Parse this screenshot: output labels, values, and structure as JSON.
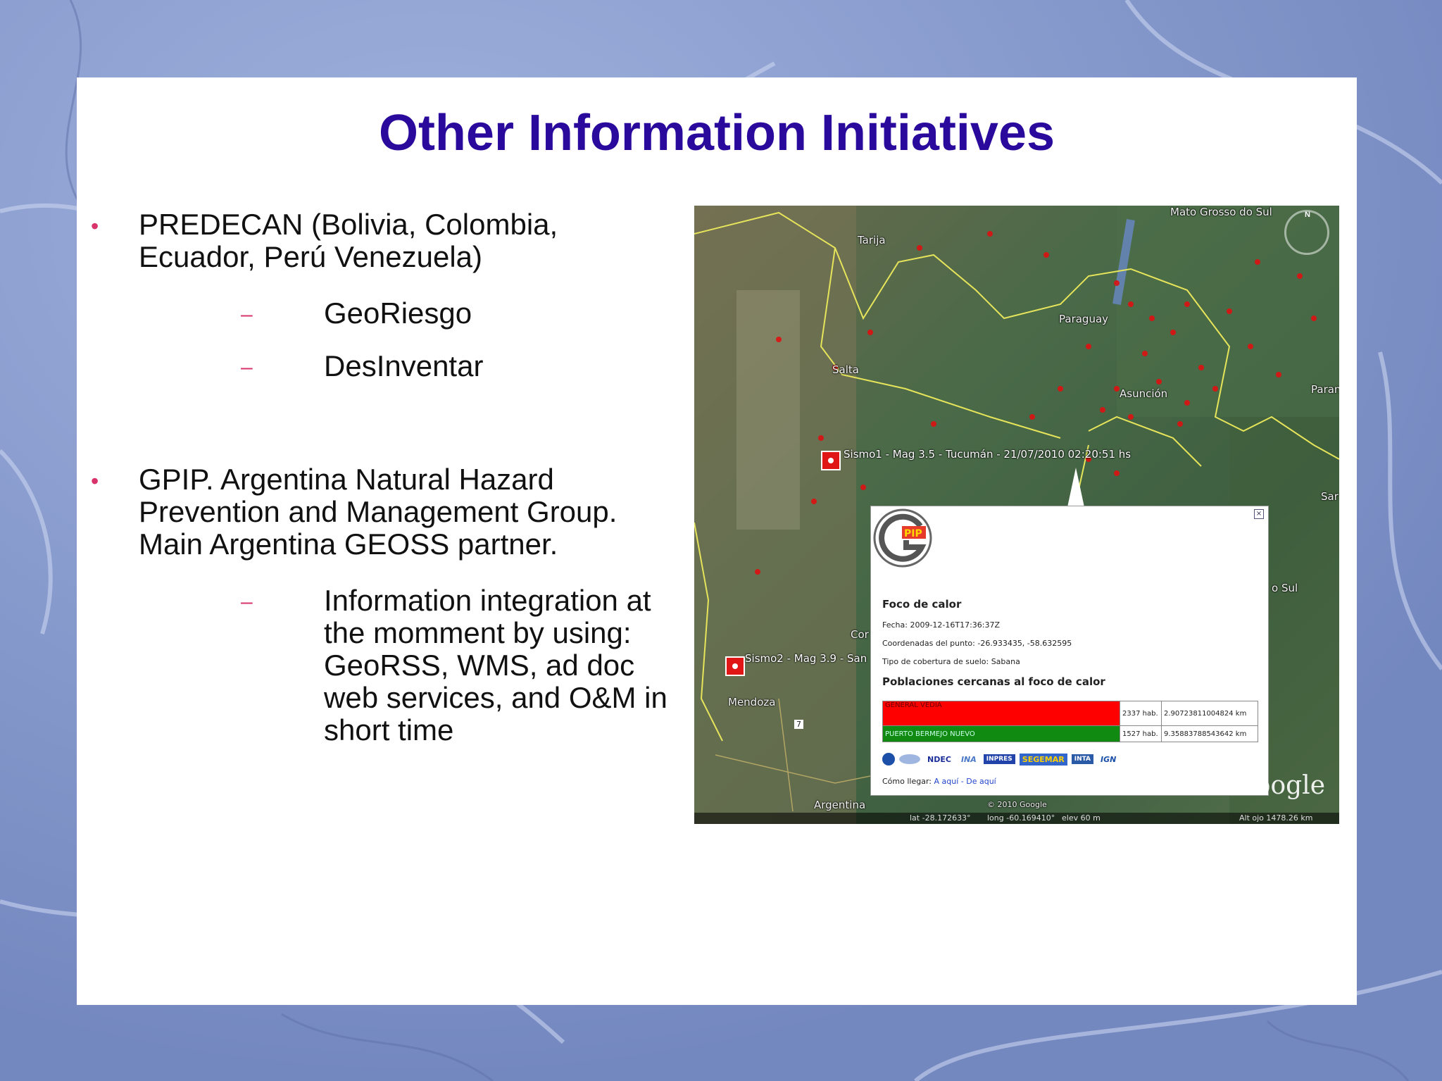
{
  "slide": {
    "title": "Other Information Initiatives",
    "bullets": [
      {
        "text": "PREDECAN (Bolivia, Colombia,\nEcuador, Perú Venezuela)",
        "subitems": [
          "GeoRiesgo",
          "DesInventar"
        ]
      },
      {
        "text": "GPIP. Argentina Natural Hazard\nPrevention and Management Group.\nMain Argentina GEOSS partner.",
        "subitems": [
          "Information integration at\nthe momment by using:\nGeoRSS, WMS, ad doc\nweb services, and O&M in\nshort time"
        ]
      }
    ],
    "bullet_glyph": "•",
    "dash_glyph": "–"
  },
  "map": {
    "places": {
      "mato_grosso": "Mato Grosso do Sul",
      "tarija": "Tarija",
      "paraguay": "Paraguay",
      "salta": "Salta",
      "asuncion": "Asunción",
      "parana": "Paran",
      "sar": "Sar",
      "sul": "o Sul",
      "cor": "Cor",
      "mendoza": "Mendoza",
      "argentina": "Argentina",
      "route": "7"
    },
    "quake1": "Sismo1 - Mag 3.5 - Tucumán - 21/07/2010 02:20:51 hs",
    "quake2": "Sismo2 - Mag 3.9 - San",
    "compass_n": "N",
    "google": "oogle",
    "copyright": "© 2010 Google",
    "status": {
      "lat": "lat  -28.172633°",
      "lon": "long  -60.169410°",
      "elev": "elev   60 m",
      "alt": "Alt  ojo  1478.26 km"
    },
    "popup": {
      "close": "×",
      "logo_text": "PIP",
      "title": "Foco de calor",
      "fecha": "Fecha: 2009-12-16T17:36:37Z",
      "coords": "Coordenadas del punto: -26.933435, -58.632595",
      "cobertura": "Tipo de cobertura de suelo: Sabana",
      "subtitle": "Poblaciones cercanas al foco de calor",
      "rows": [
        {
          "name": "GENERAL VEDIA",
          "hab": "2337 hab.",
          "km": "2.90723811004824 km",
          "color": "#ff0000",
          "height": 34
        },
        {
          "name": "PUERTO BERMEJO NUEVO",
          "hab": "1527 hab.",
          "km": "9.35883788543642 km",
          "color": "#108a10",
          "height": 20
        }
      ],
      "logos": [
        "NDEC",
        "INA",
        "INPRES",
        "SEGEMAR",
        "INTA",
        "IGN"
      ],
      "howto_label": "Cómo llegar: ",
      "howto_links": "A aquí - De aquí"
    }
  },
  "colors": {
    "title": "#2a0a9c",
    "bullet": "#d8336a",
    "background": "#8b9fcf"
  }
}
